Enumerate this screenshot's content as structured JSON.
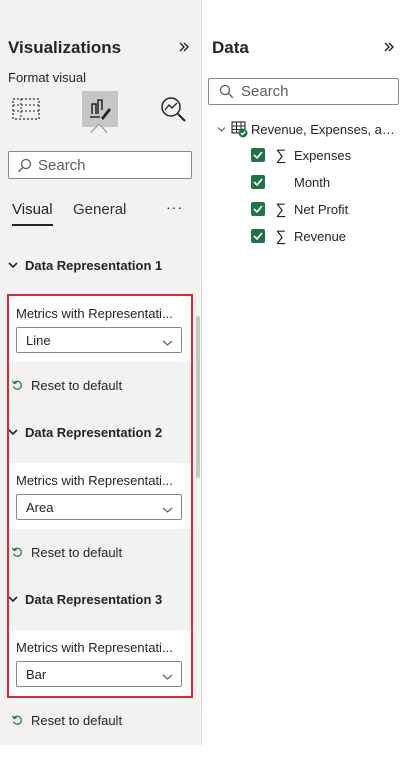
{
  "visualizations_pane": {
    "title": "Visualizations",
    "collapse_icon": "chevron-double-right-icon",
    "format_label": "Format visual",
    "icons": [
      "build-visual-icon",
      "format-visual-icon",
      "analytics-icon"
    ],
    "search": {
      "placeholder": "Search"
    },
    "tabs": [
      {
        "label": "Visual",
        "active": true
      },
      {
        "label": "General",
        "active": false
      }
    ],
    "more_label": "···",
    "sections": [
      {
        "header": "Data Representation 1",
        "field_label": "Metrics with Representati...",
        "selected": "Line",
        "reset_label": "Reset to default"
      },
      {
        "header": "Data Representation 2",
        "field_label": "Metrics with Representati...",
        "selected": "Area",
        "reset_label": "Reset to default"
      },
      {
        "header": "Data Representation 3",
        "field_label": "Metrics with Representati...",
        "selected": "Bar",
        "reset_label": "Reset to default"
      }
    ]
  },
  "data_pane": {
    "title": "Data",
    "collapse_icon": "chevron-double-right-icon",
    "search": {
      "placeholder": "Search"
    },
    "table": {
      "name": "Revenue, Expenses, an...",
      "fields": [
        {
          "name": "Expenses",
          "checked": true,
          "sigma": true
        },
        {
          "name": "Month",
          "checked": true,
          "sigma": false
        },
        {
          "name": "Net Profit",
          "checked": true,
          "sigma": true
        },
        {
          "name": "Revenue",
          "checked": true,
          "sigma": true
        }
      ]
    }
  },
  "colors": {
    "pane_bg": "#f3f2f1",
    "checkbox_green": "#217346",
    "highlight_red": "#d22c38",
    "selected_icon_bg": "#c8c6c4"
  }
}
